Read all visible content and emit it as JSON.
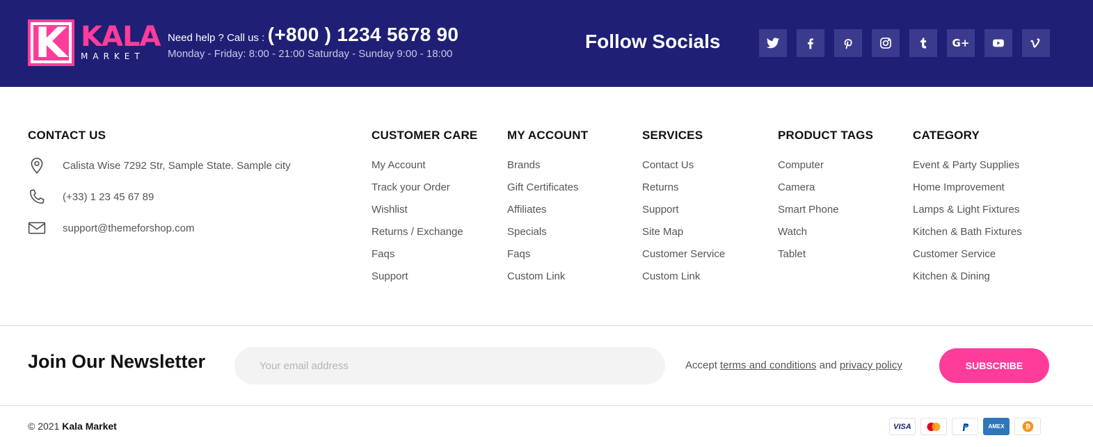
{
  "brand": {
    "logo_letter": "K",
    "logo_word": "KALA",
    "logo_sub": "MARKET",
    "accent_color": "#ff3c9a",
    "primary_color": "#1f1f75"
  },
  "header": {
    "help_label": "Need help ? Call us :",
    "phone": "(+800 ) 1234 5678 90",
    "hours": "Monday - Friday: 8:00 - 21:00 Saturday - Sunday 9:00 - 18:00",
    "follow_title": "Follow Socials",
    "socials": [
      {
        "name": "twitter-icon"
      },
      {
        "name": "facebook-icon"
      },
      {
        "name": "pinterest-icon"
      },
      {
        "name": "instagram-icon"
      },
      {
        "name": "tumblr-icon"
      },
      {
        "name": "google-plus-icon",
        "glyph": "G+"
      },
      {
        "name": "youtube-icon"
      },
      {
        "name": "vimeo-icon"
      }
    ]
  },
  "contact": {
    "title": "CONTACT US",
    "address": "Calista Wise 7292 Str, Sample State. Sample city",
    "phone": "(+33) 1 23 45 67 89",
    "email": "support@themeforshop.com"
  },
  "columns": [
    {
      "title": "CUSTOMER CARE",
      "items": [
        "My Account",
        "Track your Order",
        "Wishlist",
        "Returns / Exchange",
        "Faqs",
        "Support"
      ]
    },
    {
      "title": "MY ACCOUNT",
      "items": [
        "Brands",
        "Gift Certificates",
        "Affiliates",
        "Specials",
        "Faqs",
        "Custom Link"
      ]
    },
    {
      "title": "SERVICES",
      "items": [
        "Contact Us",
        "Returns",
        "Support",
        "Site Map",
        "Customer Service",
        "Custom Link"
      ]
    },
    {
      "title": "PRODUCT TAGS",
      "items": [
        "Computer",
        "Camera",
        "Smart Phone",
        "Watch",
        "Tablet"
      ]
    },
    {
      "title": "CATEGORY",
      "items": [
        "Event & Party Supplies",
        "Home Improvement",
        "Lamps & Light Fixtures",
        "Kitchen & Bath Fixtures",
        "Customer Service",
        "Kitchen & Dining"
      ]
    }
  ],
  "newsletter": {
    "title": "Join Our Newsletter",
    "email_placeholder": "Your email address",
    "accept_prefix": "Accept",
    "terms_link": "terms and conditions",
    "and_text": "and",
    "privacy_link": "privacy policy",
    "subscribe_label": "SUBSCRIBE"
  },
  "footer": {
    "copyright_prefix": "© 2021",
    "company": "Kala Market",
    "payments": [
      {
        "name": "visa-icon",
        "label": "VISA"
      },
      {
        "name": "mastercard-icon",
        "label": ""
      },
      {
        "name": "paypal-icon",
        "label": ""
      },
      {
        "name": "amex-icon",
        "label": "AMEX"
      },
      {
        "name": "bitcoin-icon",
        "label": ""
      }
    ]
  }
}
